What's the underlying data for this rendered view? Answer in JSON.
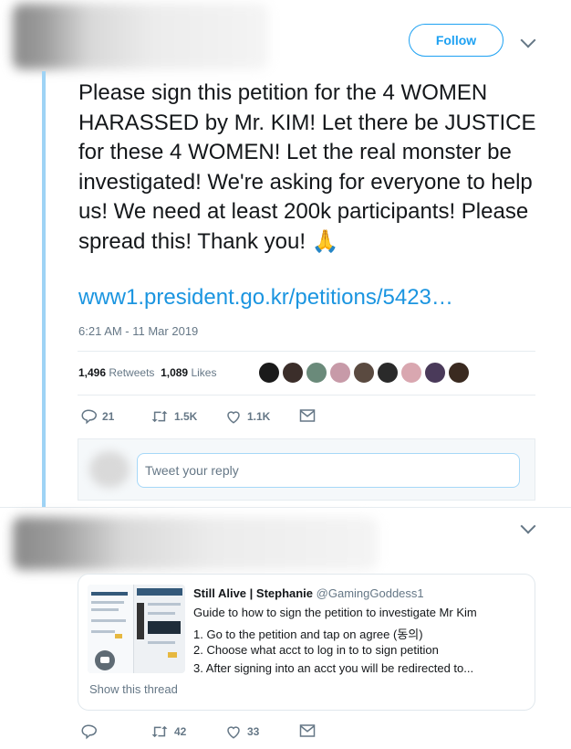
{
  "tweet": {
    "follow_label": "Follow",
    "text": "Please sign this petition for the 4 WOMEN HARASSED by Mr. KIM! Let there be JUSTICE for these 4 WOMEN! Let the real monster be investigated! We're asking for everyone to help us! We need at least 200k participants! Please spread this! Thank you! 🙏",
    "link": "www1.president.go.kr/petitions/5423…",
    "timestamp": "6:21 AM - 11 Mar 2019",
    "retweets_count": "1,496",
    "retweets_label": "Retweets",
    "likes_count": "1,089",
    "likes_label": "Likes",
    "actions": {
      "replies": "21",
      "retweets": "1.5K",
      "likes": "1.1K"
    },
    "reply_placeholder": "Tweet your reply"
  },
  "avatar_colors": [
    "#1a1a1a",
    "#3b2e2a",
    "#6a8a7a",
    "#c79aa8",
    "#5a4a40",
    "#2a2a2a",
    "#d9a7b0",
    "#4a3a5a",
    "#3a2a20"
  ],
  "quoted": {
    "name": "Still Alive | Stephanie",
    "handle": "@GamingGoddess1",
    "lines": [
      "Guide to how to sign the petition to investigate Mr Kim",
      "1. Go to the petition and tap on agree (동의)",
      "2. Choose what acct to log in to to sign petition",
      "3. After signing into an acct you will be redirected to..."
    ],
    "show_thread": "Show this thread"
  },
  "second_actions": {
    "retweets": "42",
    "likes": "33"
  },
  "colors": {
    "accent": "#1da1f2",
    "link": "#1b95e0",
    "muted": "#657786",
    "thread_line": "#9ed3f5"
  }
}
